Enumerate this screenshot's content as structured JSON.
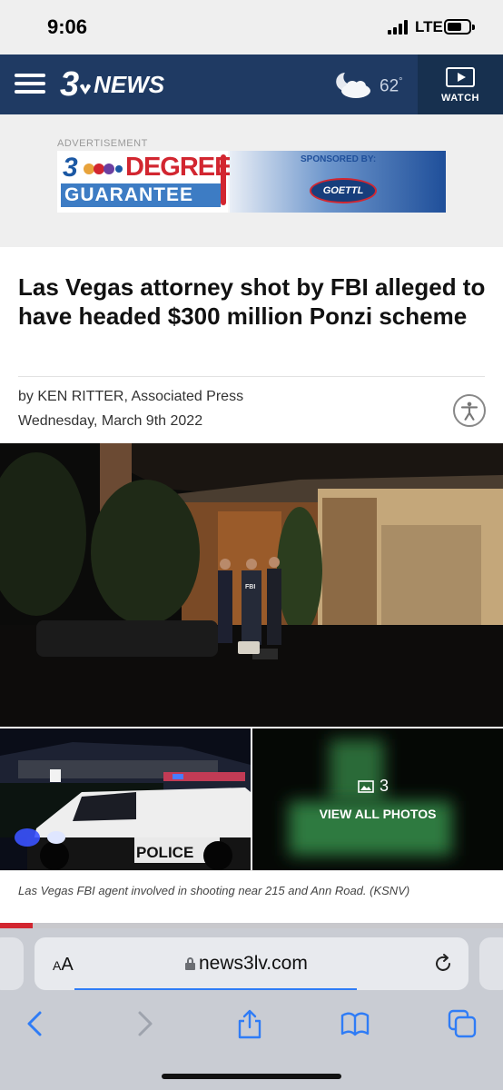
{
  "status_bar": {
    "time": "9:06",
    "network": "LTE"
  },
  "header": {
    "logo_number": "3",
    "logo_text": "NEWS",
    "weather_icon": "moon-cloud-icon",
    "temperature": "62",
    "degree_symbol": "°",
    "watch_label": "WATCH"
  },
  "advertisement": {
    "label": "ADVERTISEMENT",
    "headline_number": "3",
    "headline_rest": "DEGREE",
    "guarantee": "GUARANTEE",
    "sponsored_by": "SPONSORED BY:",
    "sponsor": "GOETTL"
  },
  "article": {
    "headline": "Las Vegas attorney shot by FBI alleged to have headed $300 million Ponzi scheme",
    "byline": "by KEN RITTER, Associated Press",
    "date": "Wednesday, March 9th 2022",
    "accessibility_icon": "accessibility-icon",
    "photo_count": "3",
    "view_all_label": "VIEW ALL PHOTOS",
    "caption": "Las Vegas FBI agent involved in shooting near 215 and Ann Road. (KSNV)",
    "photo_labels": {
      "fbi_vest": "FBI",
      "police_car": "POLICE"
    }
  },
  "browser": {
    "text_size_label_small": "A",
    "text_size_label_large": "A",
    "url": "news3lv.com",
    "page_load_progress": 0.65,
    "toolbar": [
      "back-icon",
      "forward-icon",
      "share-icon",
      "bookmarks-icon",
      "tabs-icon"
    ]
  },
  "colors": {
    "header_bg": "#1f3a63",
    "accent_blue": "#2f7cf6",
    "ad_red": "#d22630"
  }
}
